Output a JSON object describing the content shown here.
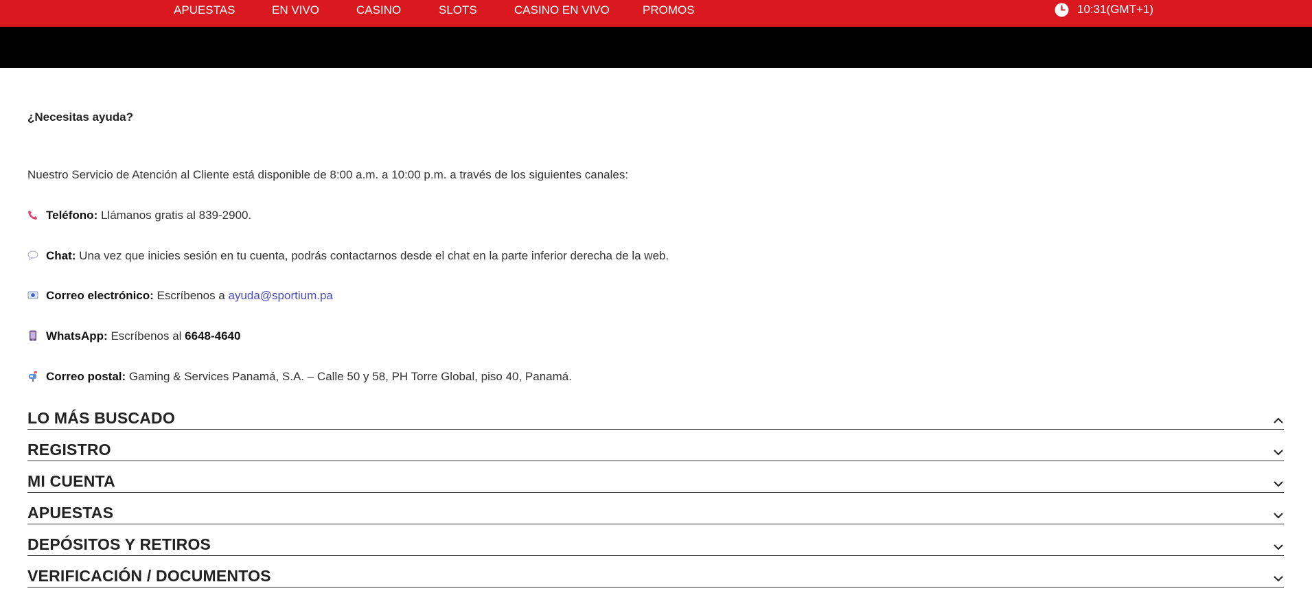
{
  "nav": {
    "items": [
      {
        "label": "APUESTAS"
      },
      {
        "label": "EN VIVO"
      },
      {
        "label": "CASINO"
      },
      {
        "label": "SLOTS"
      },
      {
        "label": "CASINO EN VIVO"
      },
      {
        "label": "PROMOS"
      }
    ],
    "clock": "10:31(GMT+1)"
  },
  "help": {
    "title": "¿Necesitas ayuda?",
    "intro": "Nuestro Servicio de Atención al Cliente está disponible de 8:00 a.m. a 10:00 p.m. a través de los siguientes canales:",
    "phone": {
      "label": "Teléfono:",
      "text": " Llámanos gratis al 839-2900."
    },
    "chat": {
      "label": "Chat:",
      "text": " Una vez que inicies sesión en tu cuenta, podrás contactarnos desde el chat en la parte inferior derecha de la web."
    },
    "email": {
      "label": "Correo electrónico:",
      "text": " Escríbenos a ",
      "address": "ayuda@sportium.pa"
    },
    "whatsapp": {
      "label": "WhatsApp:",
      "text": " Escríbenos al ",
      "number": "6648-4640"
    },
    "postal": {
      "label": "Correo postal:",
      "text": " Gaming & Services Panamá, S.A. – Calle 50 y 58, PH Torre Global, piso 40, Panamá."
    }
  },
  "accordion": [
    {
      "title": "LO MÁS BUSCADO",
      "expanded": true
    },
    {
      "title": "REGISTRO",
      "expanded": false
    },
    {
      "title": "MI CUENTA",
      "expanded": false
    },
    {
      "title": "APUESTAS",
      "expanded": false
    },
    {
      "title": "DEPÓSITOS Y RETIROS",
      "expanded": false
    },
    {
      "title": "VERIFICACIÓN / DOCUMENTOS",
      "expanded": false
    }
  ],
  "colors": {
    "brand_red": "#d9181f",
    "link": "#4a4ac4"
  }
}
